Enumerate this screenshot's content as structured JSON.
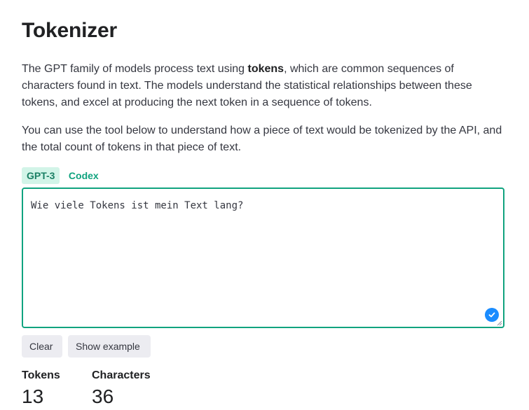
{
  "page": {
    "title": "Tokenizer",
    "intro": {
      "before": "The GPT family of models process text using ",
      "bold": "tokens",
      "after": ", which are common sequences of characters found in text. The models understand the statistical relationships between these tokens, and excel at producing the next token in a sequence of tokens."
    },
    "usage": "You can use the tool below to understand how a piece of text would be tokenized by the API, and the total count of tokens in that piece of text."
  },
  "tabs": [
    {
      "label": "GPT-3",
      "active": true
    },
    {
      "label": "Codex",
      "active": false
    }
  ],
  "input": {
    "value": "Wie viele Tokens ist mein Text lang?",
    "status_icon": "check-circle-icon"
  },
  "buttons": {
    "clear": "Clear",
    "show_example": "Show example"
  },
  "stats": {
    "tokens_label": "Tokens",
    "tokens_value": "13",
    "characters_label": "Characters",
    "characters_value": "36"
  },
  "colors": {
    "accent": "#10a37f",
    "tab_active_bg": "#d2f4e8",
    "badge": "#1a8cff",
    "button_bg": "#ececf1"
  }
}
